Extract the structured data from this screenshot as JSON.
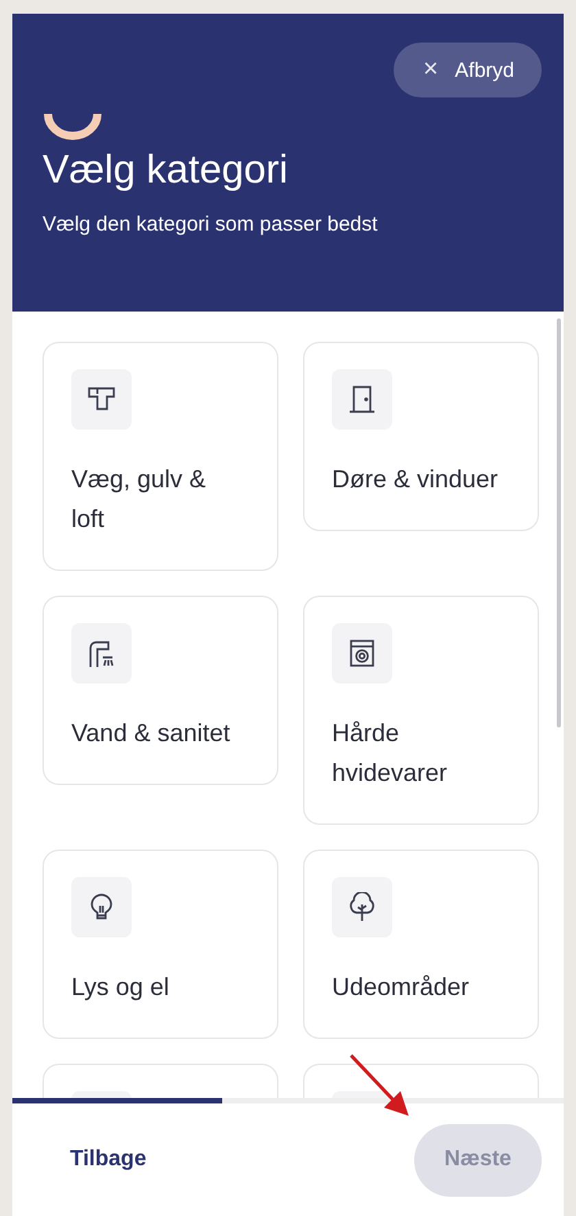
{
  "header": {
    "cancel_button": {
      "icon": "×",
      "label": "Afbryd"
    },
    "title": "Vælg kategori",
    "subtitle": "Vælg den kategori som passer bedst"
  },
  "categories": [
    {
      "kind": "full",
      "label": "Væg, gulv & loft"
    },
    {
      "kind": "full",
      "label": "Døre & vinduer"
    },
    {
      "kind": "full",
      "label": "Vand & sanitet"
    },
    {
      "kind": "full",
      "label": "Hårde hvidevarer"
    },
    {
      "kind": "full",
      "label": "Lys og el"
    },
    {
      "kind": "full",
      "label": "Udeområder"
    },
    {
      "kind": "partial"
    },
    {
      "kind": "partial"
    }
  ],
  "progress": {
    "level": 0.38
  },
  "footer": {
    "back_button": "Tilbage",
    "next_button": {
      "label": "Næste",
      "disabled": true
    }
  }
}
